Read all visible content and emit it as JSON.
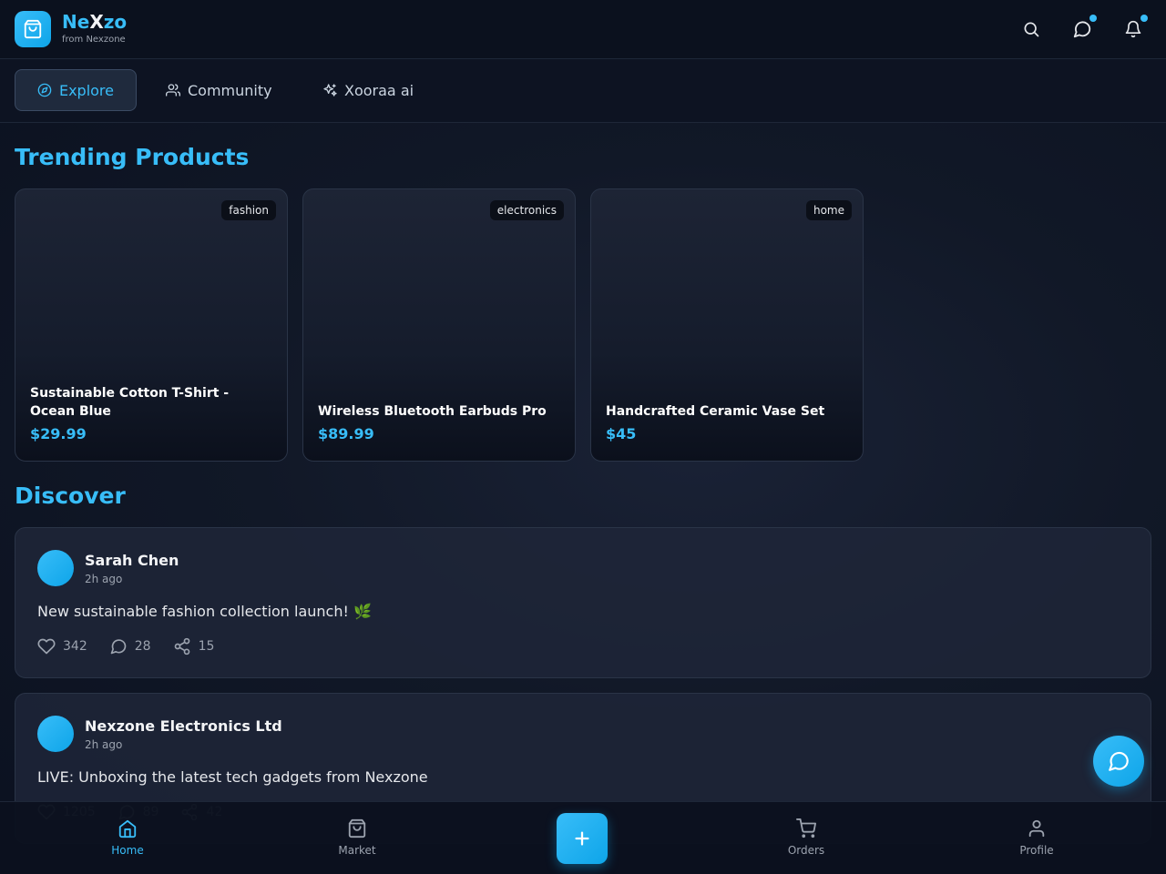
{
  "header": {
    "brand_part1": "Ne",
    "brand_part2": "X",
    "brand_part3": "zo",
    "brand_sub": "from Nexzone",
    "icons": [
      "search-icon",
      "chat-icon",
      "bell-icon"
    ]
  },
  "tabs": [
    {
      "label": "Explore",
      "icon": "compass-icon",
      "active": true
    },
    {
      "label": "Community",
      "icon": "users-icon",
      "active": false
    },
    {
      "label": "Xooraa ai",
      "icon": "sparkles-icon",
      "active": false
    }
  ],
  "trending": {
    "title": "Trending Products",
    "products": [
      {
        "category": "fashion",
        "name": "Sustainable Cotton T-Shirt - Ocean Blue",
        "price": "$29.99"
      },
      {
        "category": "electronics",
        "name": "Wireless Bluetooth Earbuds Pro",
        "price": "$89.99"
      },
      {
        "category": "home",
        "name": "Handcrafted Ceramic Vase Set",
        "price": "$45"
      }
    ]
  },
  "discover": {
    "title": "Discover",
    "posts": [
      {
        "author": "Sarah Chen",
        "time": "2h ago",
        "text": "New sustainable fashion collection launch! 🌿",
        "likes": "342",
        "comments": "28",
        "shares": "15"
      },
      {
        "author": "Nexzone Electronics Ltd",
        "time": "2h ago",
        "text": "LIVE: Unboxing the latest tech gadgets from Nexzone",
        "likes": "1205",
        "comments": "89",
        "shares": "42"
      }
    ]
  },
  "bottom_nav": {
    "items": [
      {
        "label": "Home",
        "icon": "home-icon",
        "active": true
      },
      {
        "label": "Market",
        "icon": "bag-icon",
        "active": false
      },
      {
        "label": "Orders",
        "icon": "cart-icon",
        "active": false
      },
      {
        "label": "Profile",
        "icon": "user-icon",
        "active": false
      }
    ],
    "create_icon": "plus-icon"
  },
  "colors": {
    "accent": "#38bdf8",
    "background": "#111827"
  }
}
